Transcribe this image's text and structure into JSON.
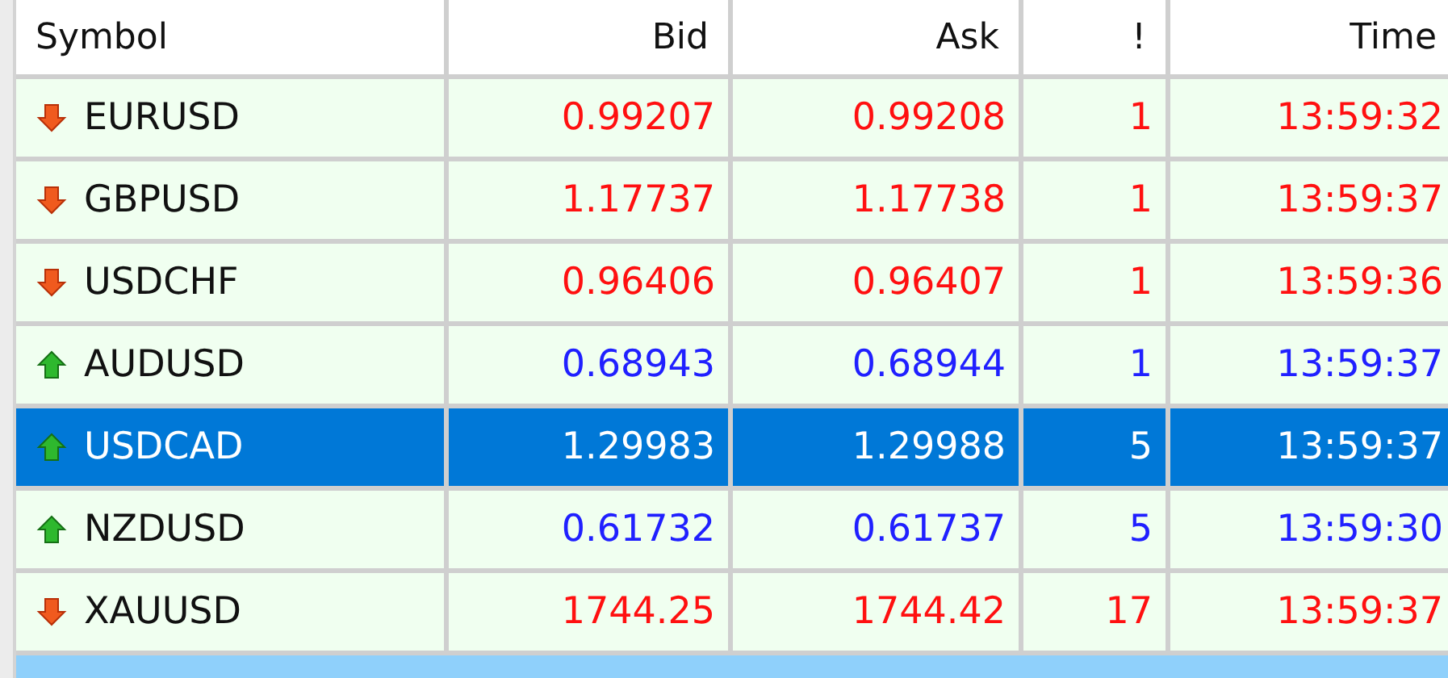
{
  "table": {
    "columns": [
      "Symbol",
      "Bid",
      "Ask",
      "!",
      "Time"
    ],
    "rows": [
      {
        "symbol": "EURUSD",
        "bid": "0.99207",
        "ask": "0.99208",
        "spread": "1",
        "time": "13:59:32",
        "kind": "down",
        "selected": false
      },
      {
        "symbol": "GBPUSD",
        "bid": "1.17737",
        "ask": "1.17738",
        "spread": "1",
        "time": "13:59:37",
        "kind": "down",
        "selected": false
      },
      {
        "symbol": "USDCHF",
        "bid": "0.96406",
        "ask": "0.96407",
        "spread": "1",
        "time": "13:59:36",
        "kind": "down",
        "selected": false
      },
      {
        "symbol": "AUDUSD",
        "bid": "0.68943",
        "ask": "0.68944",
        "spread": "1",
        "time": "13:59:37",
        "kind": "up",
        "selected": false
      },
      {
        "symbol": "USDCAD",
        "bid": "1.29983",
        "ask": "1.29988",
        "spread": "5",
        "time": "13:59:37",
        "kind": "up",
        "selected": true
      },
      {
        "symbol": "NZDUSD",
        "bid": "0.61732",
        "ask": "0.61737",
        "spread": "5",
        "time": "13:59:30",
        "kind": "up",
        "selected": false
      },
      {
        "symbol": "XAUUSD",
        "bid": "1744.25",
        "ask": "1744.42",
        "spread": "17",
        "time": "13:59:37",
        "kind": "down",
        "selected": false
      }
    ],
    "partial_row": {
      "highlighted": true
    }
  }
}
